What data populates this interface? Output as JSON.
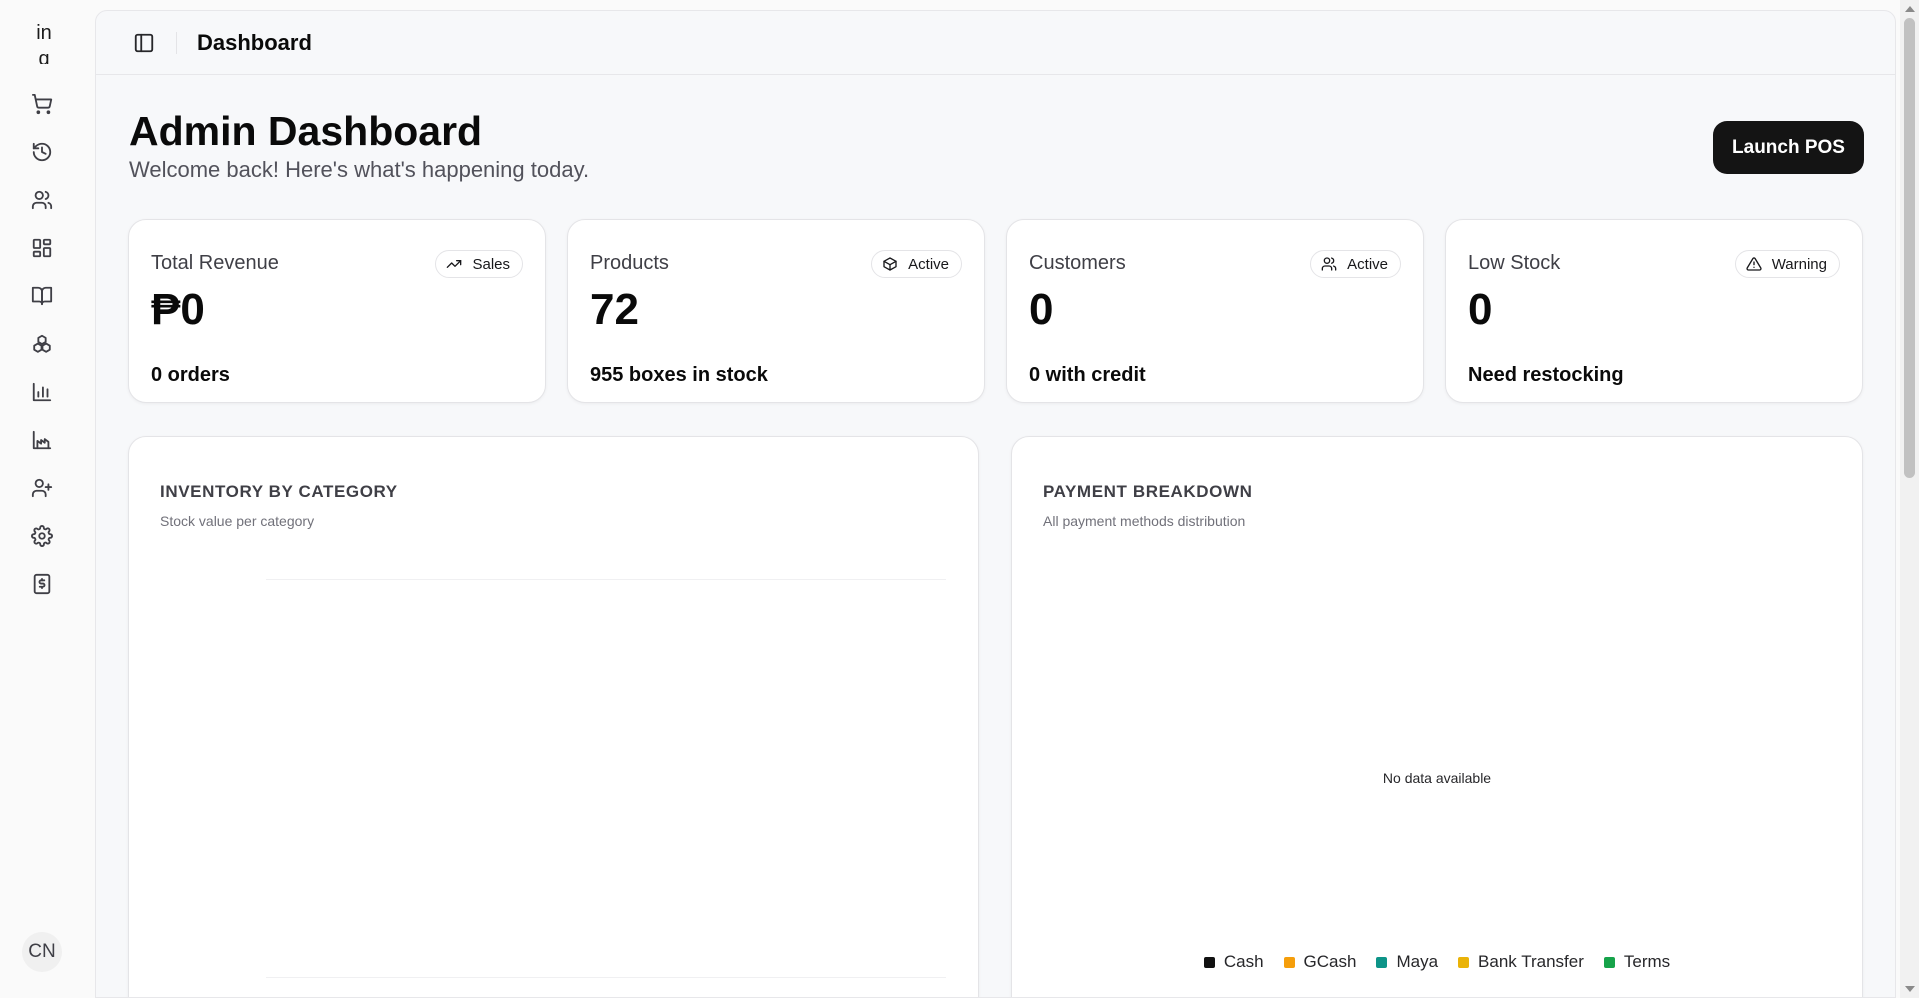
{
  "brand": {
    "text": "in"
  },
  "sidebar": {
    "items": [
      {
        "name": "cart-icon"
      },
      {
        "name": "history-icon"
      },
      {
        "name": "users-icon"
      },
      {
        "name": "dashboard-grid-icon"
      },
      {
        "name": "book-open-icon"
      },
      {
        "name": "boxes-icon"
      },
      {
        "name": "bar-chart-icon"
      },
      {
        "name": "factory-chart-icon"
      },
      {
        "name": "user-plus-icon"
      },
      {
        "name": "gear-icon"
      },
      {
        "name": "receipt-dollar-icon"
      }
    ],
    "avatar": "CN"
  },
  "topbar": {
    "title": "Dashboard"
  },
  "header": {
    "title": "Admin Dashboard",
    "subtitle": "Welcome back! Here's what's happening today.",
    "launch_button": "Launch POS"
  },
  "stats": [
    {
      "label": "Total Revenue",
      "badge": "Sales",
      "badge_icon": "trending-up-icon",
      "value": "₱0",
      "footer": "0 orders"
    },
    {
      "label": "Products",
      "badge": "Active",
      "badge_icon": "package-icon",
      "value": "72",
      "footer": "955 boxes in stock"
    },
    {
      "label": "Customers",
      "badge": "Active",
      "badge_icon": "users-icon",
      "value": "0",
      "footer": "0 with credit"
    },
    {
      "label": "Low Stock",
      "badge": "Warning",
      "badge_icon": "warning-triangle-icon",
      "value": "0",
      "footer": "Need restocking"
    }
  ],
  "inventory_panel": {
    "title": "INVENTORY BY CATEGORY",
    "subtitle": "Stock value per category"
  },
  "payment_panel": {
    "title": "PAYMENT BREAKDOWN",
    "subtitle": "All payment methods distribution",
    "empty_text": "No data available",
    "legend": [
      {
        "label": "Cash",
        "color": "#111111"
      },
      {
        "label": "GCash",
        "color": "#f59e0b"
      },
      {
        "label": "Maya",
        "color": "#0d9488"
      },
      {
        "label": "Bank Transfer",
        "color": "#eab308"
      },
      {
        "label": "Terms",
        "color": "#16a34a"
      }
    ]
  }
}
